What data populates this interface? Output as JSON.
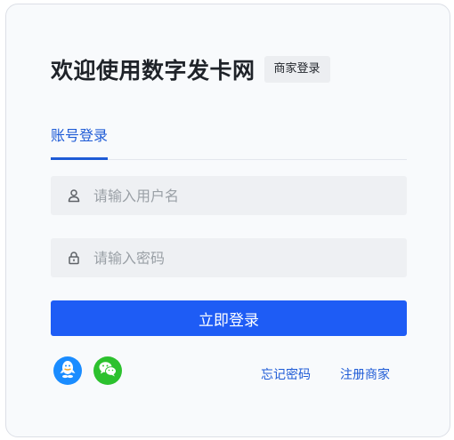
{
  "header": {
    "title": "欢迎使用数字发卡网",
    "merchant_login_badge": "商家登录"
  },
  "tabs": [
    {
      "label": "账号登录",
      "active": true
    }
  ],
  "form": {
    "username": {
      "placeholder": "请输入用户名",
      "value": "",
      "icon": "user-icon"
    },
    "password": {
      "placeholder": "请输入密码",
      "value": "",
      "icon": "lock-icon"
    },
    "submit_label": "立即登录"
  },
  "social": [
    {
      "name": "qq",
      "icon": "qq-icon",
      "color": "#1a8cff"
    },
    {
      "name": "wechat",
      "icon": "wechat-icon",
      "color": "#2cc12e"
    }
  ],
  "links": {
    "forgot_password": "忘记密码",
    "register_merchant": "注册商家"
  },
  "colors": {
    "primary": "#1e5cf5",
    "link": "#1e5bd6",
    "card_background": "#f8fafc",
    "field_background": "#eef0f3"
  }
}
